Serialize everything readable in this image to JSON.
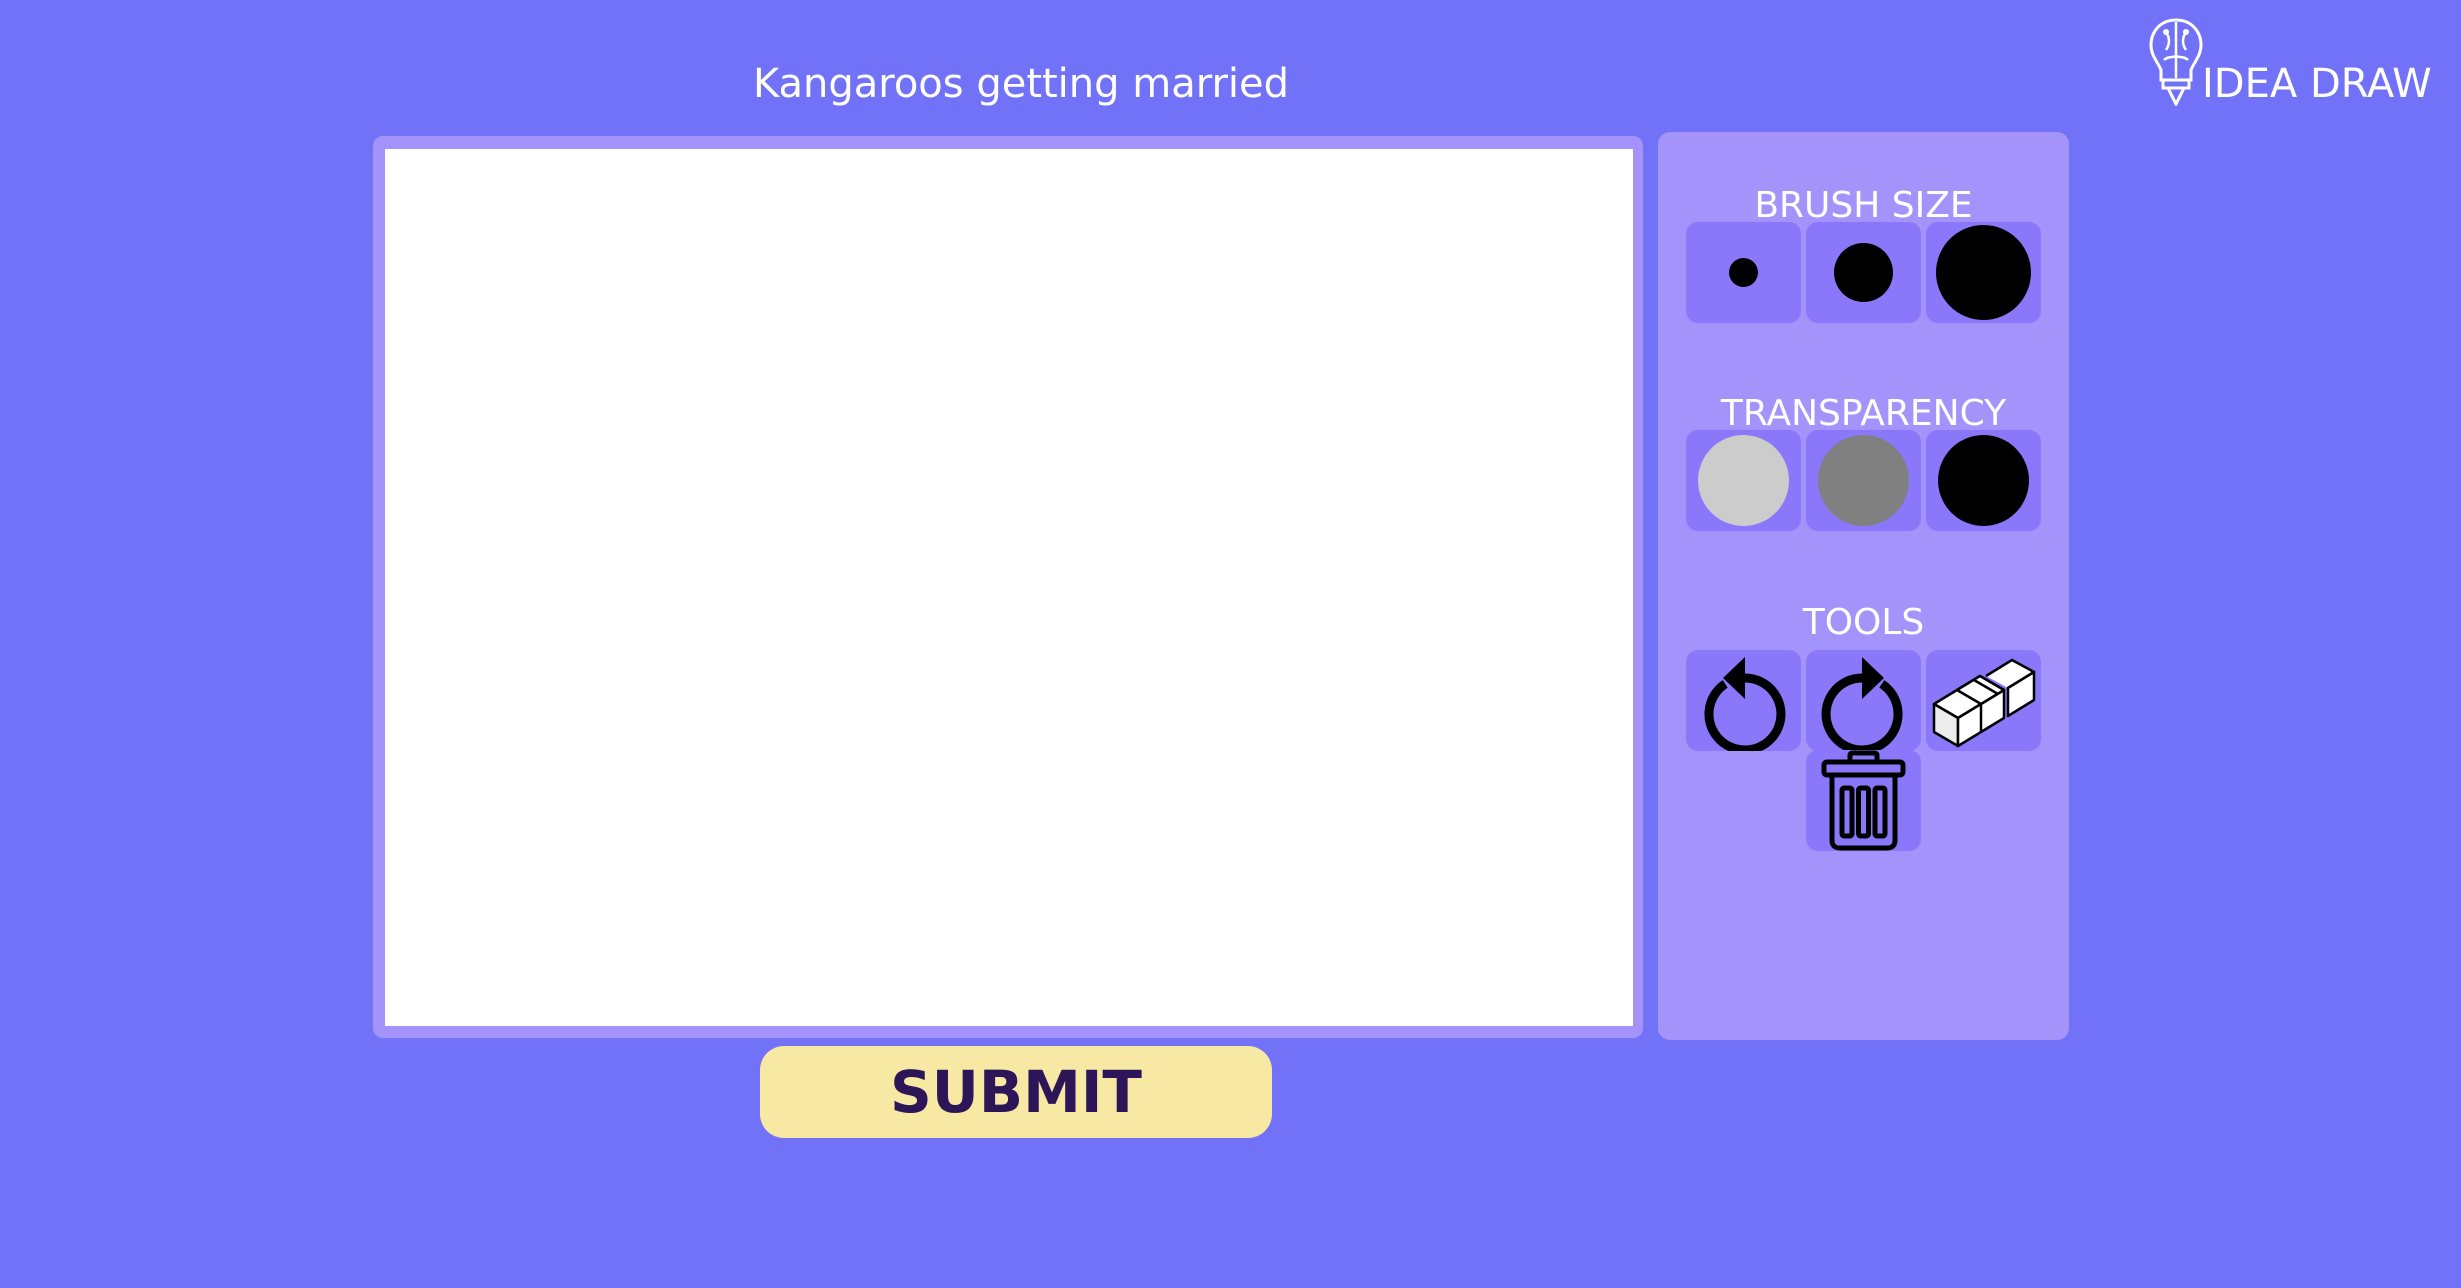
{
  "prompt": "Kangaroos getting married",
  "submit_label": "SUBMIT",
  "logo_text": "IDEA DRAW",
  "panel": {
    "brush_size_title": "BRUSH SIZE",
    "transparency_title": "TRANSPARENCY",
    "tools_title": "TOOLS"
  },
  "brush_sizes": [
    "small",
    "medium",
    "large"
  ],
  "transparency_levels": [
    "light",
    "medium",
    "opaque"
  ],
  "tools": [
    "undo-icon",
    "redo-icon",
    "eraser-icon",
    "trash-icon"
  ],
  "colors": {
    "background": "#7272f9",
    "panel": "#a393fa",
    "button": "#8b77fa",
    "submit_bg": "#f7e8a4",
    "submit_text": "#2c1657",
    "transparency_light": "#cccccc",
    "transparency_medium": "#808080",
    "transparency_opaque": "#000000"
  }
}
